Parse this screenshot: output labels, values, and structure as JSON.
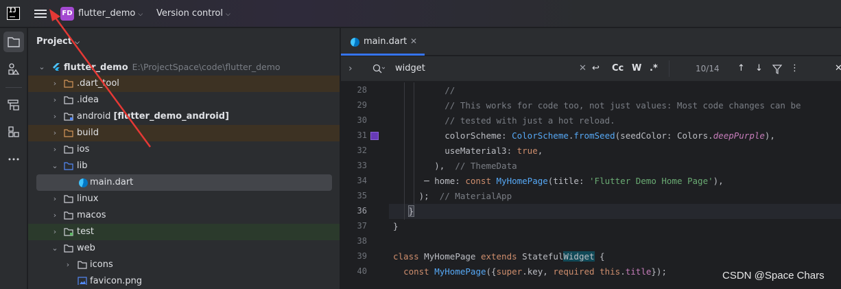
{
  "titlebar": {
    "project_badge": "FD",
    "project_name": "flutter_demo",
    "vcs_label": "Version control",
    "logo_text": "IJ"
  },
  "toolstrip": [
    "folder-icon",
    "structure-icon",
    "build-icon",
    "plugins-icon",
    "more-icon"
  ],
  "project_panel": {
    "title": "Project",
    "tree": [
      {
        "label": "flutter_demo",
        "path": "E:\\ProjectSpace\\code\\flutter_demo",
        "expanded": true,
        "icon": "flutter-module-icon"
      },
      {
        "label": ".dart_tool",
        "expanded": false,
        "icon": "excluded-folder-icon"
      },
      {
        "label": ".idea",
        "expanded": false,
        "icon": "folder-icon"
      },
      {
        "label": "android",
        "suffix": "[flutter_demo_android]",
        "expanded": false,
        "icon": "module-folder-icon"
      },
      {
        "label": "build",
        "expanded": false,
        "icon": "excluded-folder-icon"
      },
      {
        "label": "ios",
        "expanded": false,
        "icon": "folder-icon"
      },
      {
        "label": "lib",
        "expanded": true,
        "icon": "source-folder-icon"
      },
      {
        "label": "main.dart",
        "icon": "dart-file-icon"
      },
      {
        "label": "linux",
        "expanded": false,
        "icon": "folder-icon"
      },
      {
        "label": "macos",
        "expanded": false,
        "icon": "folder-icon"
      },
      {
        "label": "test",
        "expanded": false,
        "icon": "test-folder-icon"
      },
      {
        "label": "web",
        "expanded": true,
        "icon": "folder-icon"
      },
      {
        "label": "icons",
        "expanded": false,
        "icon": "folder-icon"
      },
      {
        "label": "favicon.png",
        "icon": "image-file-icon"
      }
    ]
  },
  "editor": {
    "tab": {
      "label": "main.dart",
      "close": "✕"
    },
    "find": {
      "query": "widget",
      "match_case": "Cc",
      "words": "W",
      "regex": ".*",
      "count": "10/14"
    },
    "current_line": 36,
    "color_swatch_line": 31,
    "colors": {
      "swatch": "#673ab7",
      "accent": "#3574f0"
    },
    "lines": [
      28,
      29,
      30,
      31,
      32,
      33,
      34,
      35,
      36,
      37,
      38,
      39,
      40
    ]
  },
  "watermark": "CSDN @Space Chars"
}
